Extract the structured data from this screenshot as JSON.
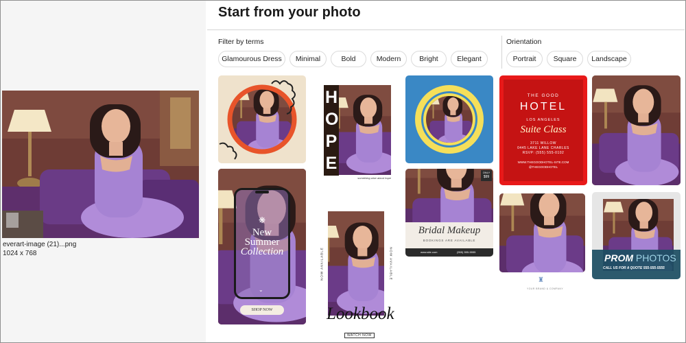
{
  "page": {
    "title": "Start from your photo"
  },
  "preview": {
    "filename": "everart-image (21)...png",
    "dimensions": "1024 x 768"
  },
  "filters": {
    "label": "Filter by terms",
    "chips": [
      "Glamourous Dress",
      "Minimal",
      "Bold",
      "Modern",
      "Bright",
      "Elegant"
    ]
  },
  "orientation": {
    "label": "Orientation",
    "chips": [
      "Portrait",
      "Square",
      "Landscape"
    ]
  },
  "templates": {
    "hope_letters": [
      "H",
      "O",
      "P",
      "E"
    ],
    "hope_caption": "something wise about hope",
    "new_summer": [
      "New",
      "Summer",
      "Collection"
    ],
    "shop_now": "SHOP NOW",
    "now_available": "NOW AVAILABLE",
    "lookbook": "Lookbook",
    "watch_now": "WATCH NOW",
    "bridal_title": "Bridal Makeup",
    "bridal_sub": "BOOKINGS ARE AVAILABLE",
    "bridal_price_top": "ONLY",
    "bridal_price": "$99",
    "bridal_web": "www.site.com",
    "bridal_phone": "(555) 555-5555",
    "hotel_the_good": "THE GOOD",
    "hotel_word": "HOTEL",
    "hotel_city": "LOS ANGELES",
    "hotel_suite": "Suite Class",
    "hotel_address": [
      "3711 WILLOW",
      "0445 LAKE LANE CHARLES",
      "RSVP: (555) 555-0102"
    ],
    "hotel_site": "WWW.THEGOODHOTEL-SITE.COM",
    "hotel_handle": "@THEGOODHOTEL",
    "prom_word1": "PROM",
    "prom_word2": "PHOTOS",
    "prom_sub": "CALL US FOR A QUOTE 555-555-5555",
    "logo_caption": "YOUR BRAND & COMPANY"
  },
  "colors": {
    "accent_red": "#e81919",
    "accent_blue": "#3a88c5",
    "accent_yellow": "#f5df5a",
    "accent_orange": "#e8542a",
    "dress_purple": "#9b7ac9",
    "prom_teal": "#1d4f63"
  }
}
